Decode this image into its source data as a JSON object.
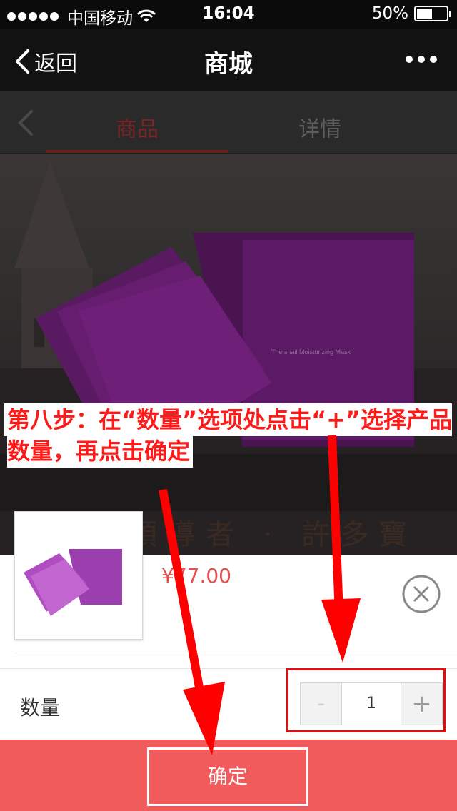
{
  "status_bar": {
    "carrier": "中国移动",
    "time": "16:04",
    "battery": "50%",
    "battery_level": 0.5,
    "signal_icon": "signal-dots-icon",
    "wifi_icon": "wifi-icon"
  },
  "nav": {
    "back_label": "返回",
    "title": "商城",
    "more_icon": "more-dots-icon"
  },
  "tabs": [
    {
      "label": "商品",
      "active": true
    },
    {
      "label": "详情",
      "active": false
    }
  ],
  "banner": {
    "slogan": "領導者 · 許多寶"
  },
  "annotation": {
    "text": "第八步：在“数量”选项处点击“+”选择产品数量，再点击确定"
  },
  "product": {
    "price": "¥77.00"
  },
  "quantity": {
    "label": "数量",
    "minus": "-",
    "value": "1",
    "plus": "+"
  },
  "footer": {
    "confirm_label": "确定"
  },
  "colors": {
    "accent": "#f25b5b",
    "price": "#e44f4f",
    "annotation": "#ff1a1a"
  }
}
